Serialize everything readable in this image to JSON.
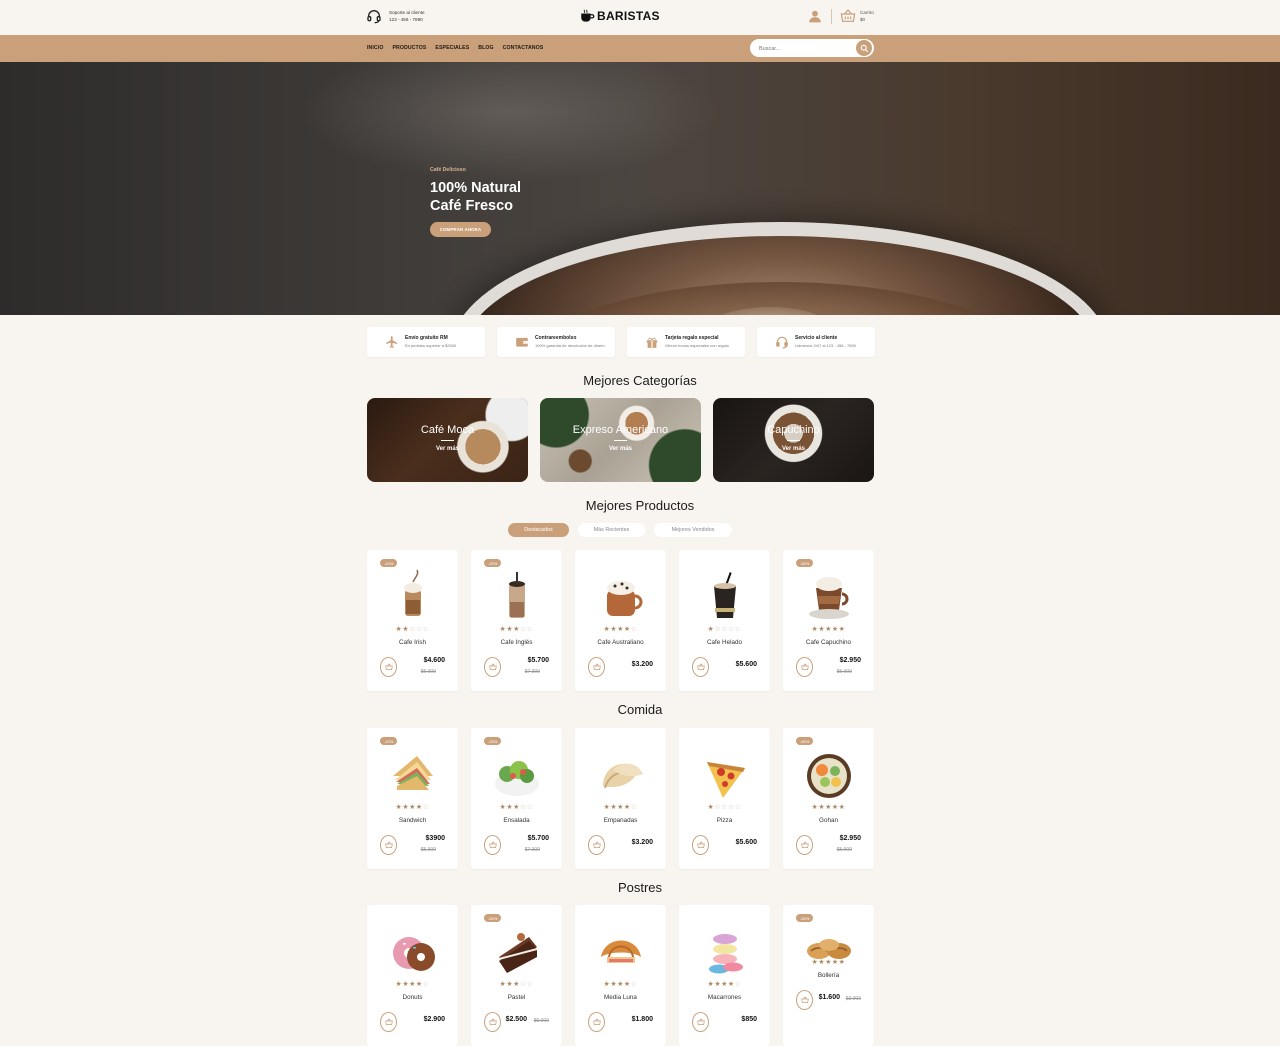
{
  "header": {
    "support_title": "Soporte al cliente",
    "support_phone": "123 - 456 - 7890",
    "brand": "BARISTAS",
    "cart_label": "Carrito",
    "cart_amount": "$0"
  },
  "nav": {
    "links": [
      "INICIO",
      "PRODUCTOS",
      "ESPECIALES",
      "BLOG",
      "CONTACTANOS"
    ],
    "search_placeholder": "Buscar..."
  },
  "hero": {
    "kicker": "Café Delicioso",
    "title_line1": "100% Natural",
    "title_line2": "Café Fresco",
    "button": "COMPRAR AHORA"
  },
  "features": [
    {
      "title": "Envío gratuito RM",
      "subtitle": "En pedidos superior a $2500",
      "icon": "airplane-icon"
    },
    {
      "title": "Contrareembolso",
      "subtitle": "100% garantía de devolución de dinero",
      "icon": "wallet-icon"
    },
    {
      "title": "Tarjeta regalo especial",
      "subtitle": "Ofrece bonos especiales con regalo",
      "icon": "gift-icon"
    },
    {
      "title": "Servicio al cliente",
      "subtitle": "Llámenos 24/7 al 123 - 456 - 7890",
      "icon": "headset-icon"
    }
  ],
  "categories_title": "Mejores Categorías",
  "categories": [
    {
      "name": "Café Moca",
      "more": "Ver más"
    },
    {
      "name": "Expreso Americano",
      "more": "Ver más"
    },
    {
      "name": "Capuchino",
      "more": "Ver más"
    }
  ],
  "products_title": "Mejores Productos",
  "tabs": [
    "Destacados",
    "Más Recientes",
    "Mejores Vendidos"
  ],
  "drinks": [
    {
      "badge": "-10%",
      "name": "Cafe Irish",
      "price": "$4.600",
      "old": "$5.300",
      "rating": 2
    },
    {
      "badge": "-20%",
      "name": "Cafe Inglés",
      "price": "$5.700",
      "old": "$7.300",
      "rating": 3
    },
    {
      "badge": "",
      "name": "Cafe Australiano",
      "price": "$3.200",
      "old": "",
      "rating": 4
    },
    {
      "badge": "",
      "name": "Cafe Helado",
      "price": "$5.600",
      "old": "",
      "rating": 1
    },
    {
      "badge": "-50%",
      "name": "Cafe Capuchino",
      "price": "$2.950",
      "old": "$5.900",
      "rating": 5
    }
  ],
  "food_title": "Comida",
  "food": [
    {
      "badge": "-10%",
      "name": "Sandwich",
      "price": "$3900",
      "old": "$5.300",
      "rating": 4
    },
    {
      "badge": "-20%",
      "name": "Ensalada",
      "price": "$5.700",
      "old": "$7.300",
      "rating": 3
    },
    {
      "badge": "",
      "name": "Empanadas",
      "price": "$3.200",
      "old": "",
      "rating": 4
    },
    {
      "badge": "",
      "name": "Pizza",
      "price": "$5.600",
      "old": "",
      "rating": 1
    },
    {
      "badge": "-50%",
      "name": "Gohan",
      "price": "$2.950",
      "old": "$5.900",
      "rating": 5
    }
  ],
  "desserts_title": "Postres",
  "desserts": [
    {
      "badge": "",
      "name": "Donuts",
      "price": "$2.900",
      "old": "",
      "rating": 4
    },
    {
      "badge": "-50%",
      "name": "Pastel",
      "price": "$2.500",
      "old": "$5.000",
      "rating": 3
    },
    {
      "badge": "",
      "name": "Media Luna",
      "price": "$1.800",
      "old": "",
      "rating": 4
    },
    {
      "badge": "",
      "name": "Macarrones",
      "price": "$850",
      "old": "",
      "rating": 4
    },
    {
      "badge": "-50%",
      "name": "Bollería",
      "price": "$1.600",
      "old": "$3.000",
      "rating": 5
    }
  ],
  "colors": {
    "accent": "#c9a07a",
    "background": "#f8f5f0",
    "hero_dark": "#3b3836"
  }
}
